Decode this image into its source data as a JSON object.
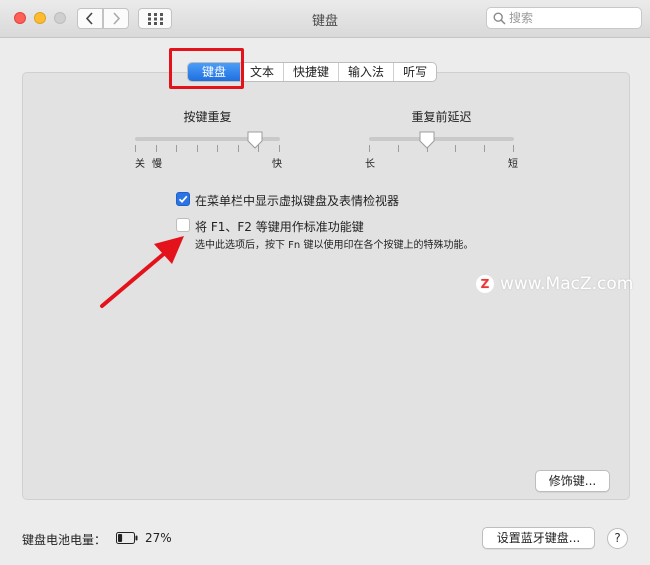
{
  "window": {
    "title": "键盘"
  },
  "search": {
    "placeholder": "搜索"
  },
  "tabs": [
    {
      "label": "键盘",
      "active": true
    },
    {
      "label": "文本",
      "active": false
    },
    {
      "label": "快捷键",
      "active": false
    },
    {
      "label": "输入法",
      "active": false
    },
    {
      "label": "听写",
      "active": false
    }
  ],
  "key_repeat": {
    "label": "按键重复",
    "min_label_1": "关",
    "min_label_2": "慢",
    "max_label": "快",
    "level": 0.83
  },
  "delay_until_repeat": {
    "label": "重复前延迟",
    "min_label": "长",
    "max_label": "短",
    "level": 0.4
  },
  "options": {
    "show_viewer": {
      "label": "在菜单栏中显示虚拟键盘及表情检视器",
      "checked": true
    },
    "fn_keys": {
      "label": "将 F1、F2 等键用作标准功能键",
      "checked": false,
      "note": "选中此选项后，按下 Fn 键以使用印在各个按键上的特殊功能。"
    }
  },
  "buttons": {
    "modifier_keys": "修饰键...",
    "bluetooth_keyboard": "设置蓝牙键盘...",
    "help": "?"
  },
  "battery": {
    "label": "键盘电池电量：",
    "percent": "27%",
    "level": 0.27
  },
  "watermark": {
    "logo": "Z",
    "text": "www.MacZ.com"
  },
  "colors": {
    "accent": "#2b74e6",
    "highlight": "#e4131b"
  }
}
